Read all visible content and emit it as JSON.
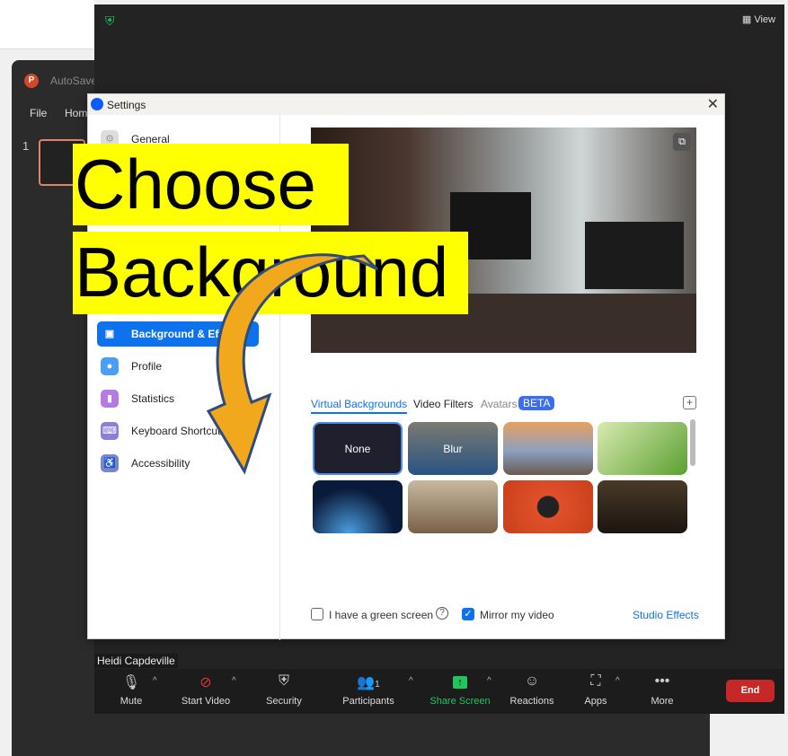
{
  "powerpoint": {
    "autosave": "AutoSave",
    "menu": [
      "File",
      "Hom"
    ],
    "slide_number": "1"
  },
  "zoom": {
    "view_label": "View",
    "name_tag": "Heidi Capdeville"
  },
  "settings": {
    "title": "Settings",
    "sidebar": [
      {
        "label": "General"
      },
      {
        "label": "Background & Effects"
      },
      {
        "label": "Profile"
      },
      {
        "label": "Statistics"
      },
      {
        "label": "Keyboard Shortcuts"
      },
      {
        "label": "Accessibility"
      }
    ],
    "tabs": {
      "virtual": "Virtual Backgrounds",
      "filters": "Video Filters",
      "avatars": "Avatars",
      "beta": "BETA"
    },
    "tiles": {
      "none": "None",
      "blur": "Blur"
    },
    "green_screen": "I have a green screen",
    "mirror": "Mirror my video",
    "studio": "Studio Effects"
  },
  "overlay": {
    "line1": "Choose",
    "line2": "Background"
  },
  "toolbar": {
    "mute": "Mute",
    "video": "Start Video",
    "security": "Security",
    "participants": "Participants",
    "participant_count": "1",
    "share": "Share Screen",
    "reactions": "Reactions",
    "apps": "Apps",
    "more": "More",
    "end": "End"
  }
}
